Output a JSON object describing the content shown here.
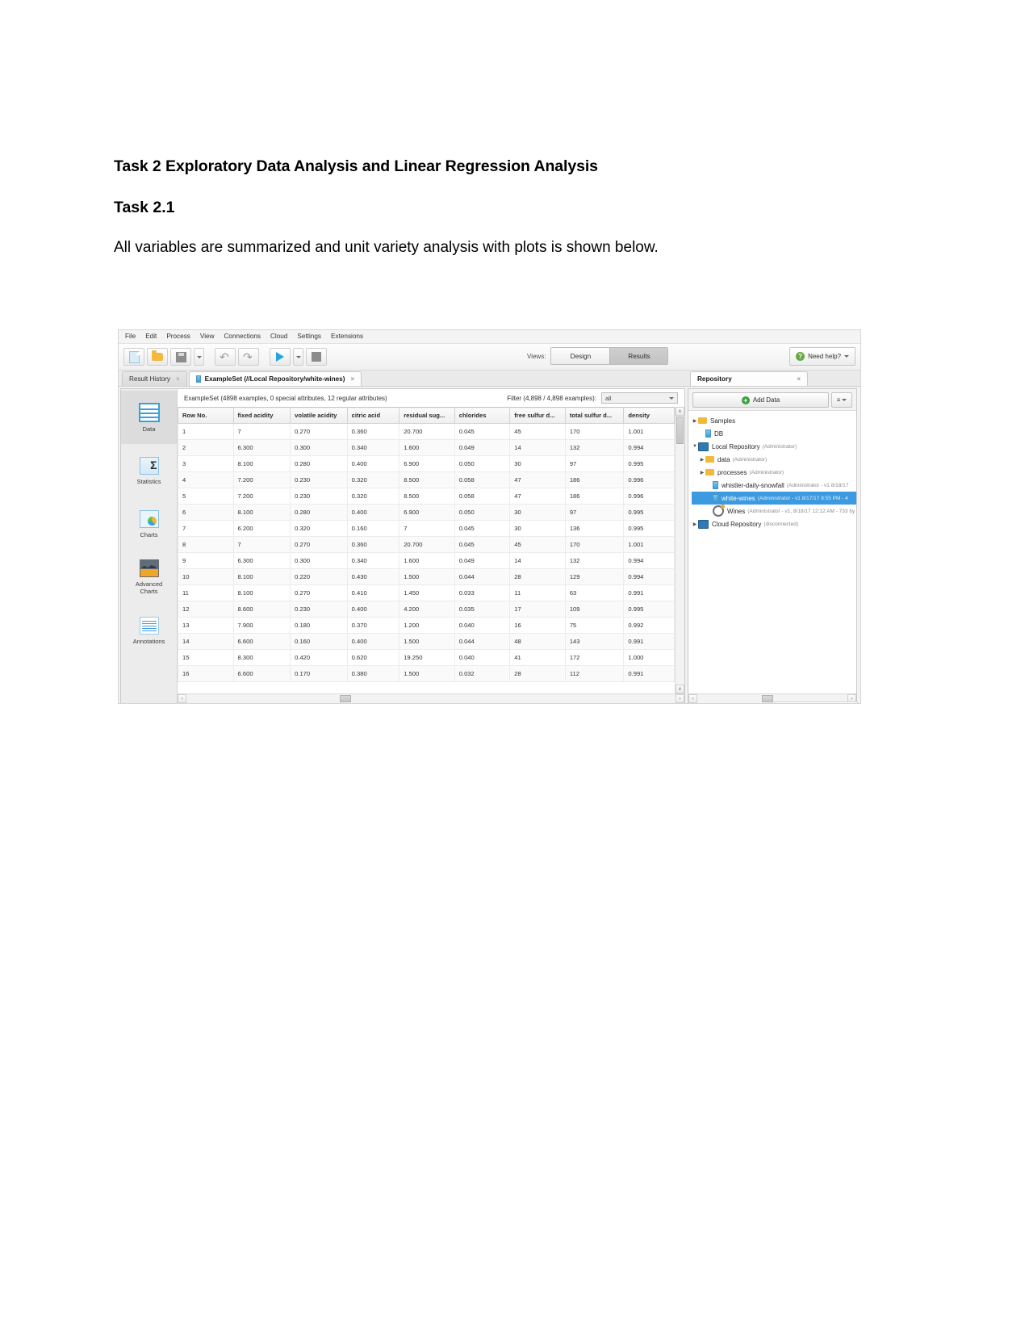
{
  "document": {
    "heading": "Task 2 Exploratory Data Analysis and Linear Regression Analysis",
    "subheading": "Task 2.1",
    "paragraph": "All variables are summarized and unit variety analysis with plots is shown below."
  },
  "app": {
    "menu": [
      "File",
      "Edit",
      "Process",
      "View",
      "Connections",
      "Cloud",
      "Settings",
      "Extensions"
    ],
    "toolbar": {
      "new_label": "new-process",
      "open_label": "open-process",
      "save_label": "save-process",
      "undo_label": "undo",
      "redo_label": "redo",
      "run_label": "run-process",
      "stop_label": "stop-process",
      "views_label": "Views:",
      "view_tabs": [
        {
          "label": "Design",
          "active": false
        },
        {
          "label": "Results",
          "active": true
        }
      ],
      "help_label": "Need help?",
      "help_glyph": "?",
      "caret_glyph": "▾"
    },
    "tabs": [
      {
        "label": "Result History",
        "active": false,
        "close": "×"
      },
      {
        "label": "ExampleSet (//Local Repository/white-wines)",
        "active": true,
        "close": "×"
      }
    ],
    "repository_tab": {
      "label": "Repository",
      "close": "×"
    },
    "sidebar": {
      "items": [
        {
          "label": "Data",
          "icon": "data-table-icon",
          "active": true
        },
        {
          "label": "Statistics",
          "icon": "sigma-statistics-icon",
          "active": false
        },
        {
          "label": "Charts",
          "icon": "pie-chart-icon",
          "active": false
        },
        {
          "label": "Advanced\nCharts",
          "label_line1": "Advanced",
          "label_line2": "Charts",
          "icon": "advanced-charts-icon",
          "active": false
        },
        {
          "label": "Annotations",
          "icon": "annotations-icon",
          "active": false
        }
      ]
    },
    "data_view": {
      "summary": "ExampleSet (4898 examples, 0 special attributes, 12 regular attributes)",
      "filter_label": "Filter (4,898 / 4,898 examples):",
      "filter_value": "all",
      "columns": [
        "Row No.",
        "fixed acidity",
        "volatile acidity",
        "citric acid",
        "residual sug...",
        "chlorides",
        "free sulfur d...",
        "total sulfur d...",
        "density"
      ],
      "rows": [
        [
          "1",
          "7",
          "0.270",
          "0.360",
          "20.700",
          "0.045",
          "45",
          "170",
          "1.001"
        ],
        [
          "2",
          "6.300",
          "0.300",
          "0.340",
          "1.600",
          "0.049",
          "14",
          "132",
          "0.994"
        ],
        [
          "3",
          "8.100",
          "0.280",
          "0.400",
          "6.900",
          "0.050",
          "30",
          "97",
          "0.995"
        ],
        [
          "4",
          "7.200",
          "0.230",
          "0.320",
          "8.500",
          "0.058",
          "47",
          "186",
          "0.996"
        ],
        [
          "5",
          "7.200",
          "0.230",
          "0.320",
          "8.500",
          "0.058",
          "47",
          "186",
          "0.996"
        ],
        [
          "6",
          "8.100",
          "0.280",
          "0.400",
          "6.900",
          "0.050",
          "30",
          "97",
          "0.995"
        ],
        [
          "7",
          "6.200",
          "0.320",
          "0.160",
          "7",
          "0.045",
          "30",
          "136",
          "0.995"
        ],
        [
          "8",
          "7",
          "0.270",
          "0.360",
          "20.700",
          "0.045",
          "45",
          "170",
          "1.001"
        ],
        [
          "9",
          "6.300",
          "0.300",
          "0.340",
          "1.600",
          "0.049",
          "14",
          "132",
          "0.994"
        ],
        [
          "10",
          "8.100",
          "0.220",
          "0.430",
          "1.500",
          "0.044",
          "28",
          "129",
          "0.994"
        ],
        [
          "11",
          "8.100",
          "0.270",
          "0.410",
          "1.450",
          "0.033",
          "11",
          "63",
          "0.991"
        ],
        [
          "12",
          "8.600",
          "0.230",
          "0.400",
          "4.200",
          "0.035",
          "17",
          "109",
          "0.995"
        ],
        [
          "13",
          "7.900",
          "0.180",
          "0.370",
          "1.200",
          "0.040",
          "16",
          "75",
          "0.992"
        ],
        [
          "14",
          "6.600",
          "0.160",
          "0.400",
          "1.500",
          "0.044",
          "48",
          "143",
          "0.991"
        ],
        [
          "15",
          "8.300",
          "0.420",
          "0.620",
          "19.250",
          "0.040",
          "41",
          "172",
          "1.000"
        ],
        [
          "16",
          "6.600",
          "0.170",
          "0.380",
          "1.500",
          "0.032",
          "28",
          "112",
          "0.991"
        ]
      ]
    },
    "repository": {
      "add_data_label": "Add Data",
      "add_data_glyph": "+",
      "menu_glyph": "≡",
      "menu_caret": "▾",
      "tree": [
        {
          "label": "Samples",
          "meta": "",
          "icon": "folder-icon",
          "toggle": "▶",
          "depth": 0,
          "selected": false
        },
        {
          "label": "DB",
          "meta": "",
          "icon": "db-icon",
          "toggle": "",
          "depth": 1,
          "selected": false
        },
        {
          "label": "Local Repository",
          "meta": "(Administrator)",
          "icon": "monitor-icon",
          "toggle": "▼",
          "depth": 0,
          "selected": false
        },
        {
          "label": "data",
          "meta": "(Administrator)",
          "icon": "folder-icon",
          "toggle": "▶",
          "depth": 1,
          "selected": false
        },
        {
          "label": "processes",
          "meta": "(Administrator)",
          "icon": "folder-icon",
          "toggle": "▶",
          "depth": 1,
          "selected": false
        },
        {
          "label": "whistler-daily-snowfall",
          "meta": "(Administrator - v1  8/18/17",
          "icon": "dataset-icon",
          "toggle": "",
          "depth": 2,
          "selected": false
        },
        {
          "label": "white-wines",
          "meta": "(Administrator - v1  8/17/17 8:55 PM - 4",
          "icon": "dataset-icon",
          "toggle": "",
          "depth": 2,
          "selected": true
        },
        {
          "label": "Wines",
          "meta": "(Administrator - v1, 8/18/17 12:12 AM - 733 by",
          "icon": "process-gear-icon",
          "toggle": "",
          "depth": 2,
          "selected": false
        },
        {
          "label": "Cloud Repository",
          "meta": "(disconnected)",
          "icon": "cloud-icon",
          "toggle": "▶",
          "depth": 0,
          "selected": false
        }
      ]
    },
    "scrollbars": {
      "up_glyph": "∧",
      "down_glyph": "∨",
      "left_glyph": "‹",
      "right_glyph": "›"
    }
  }
}
